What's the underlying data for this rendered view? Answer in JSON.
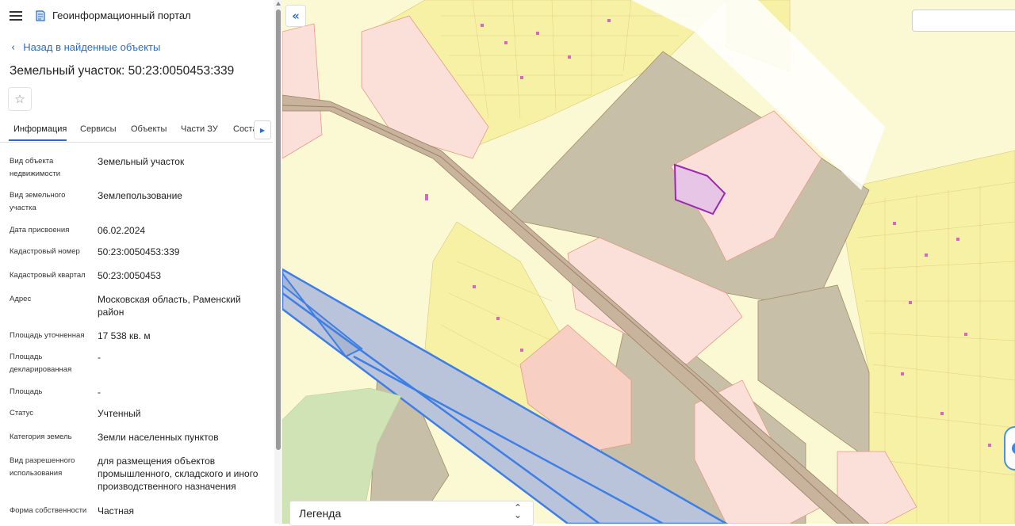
{
  "app": {
    "title": "Геоинформационный портал",
    "logo": "map-book-icon"
  },
  "nav": {
    "back_label": "Назад в найденные объекты",
    "back_icon": "chevron-left-icon"
  },
  "object": {
    "title": "Земельный участок: 50:23:0050453:339"
  },
  "tabs": [
    {
      "label": "Информация",
      "active": true
    },
    {
      "label": "Сервисы"
    },
    {
      "label": "Объекты"
    },
    {
      "label": "Части ЗУ"
    },
    {
      "label": "Соста"
    }
  ],
  "properties": [
    {
      "label": "Вид объекта недвижимости",
      "value": "Земельный участок"
    },
    {
      "label": "Вид земельного участка",
      "value": "Землепользование"
    },
    {
      "label": "Дата присвоения",
      "value": "06.02.2024"
    },
    {
      "label": "Кадастровый номер",
      "value": "50:23:0050453:339"
    },
    {
      "label": "Кадастровый квартал",
      "value": "50:23:0050453"
    },
    {
      "label": "Адрес",
      "value": "Московская область, Раменский район"
    },
    {
      "label": "Площадь уточненная",
      "value": "17 538 кв. м"
    },
    {
      "label": "Площадь декларированная",
      "value": "-"
    },
    {
      "label": "Площадь",
      "value": "-"
    },
    {
      "label": "Статус",
      "value": "Учтенный"
    },
    {
      "label": "Категория земель",
      "value": "Земли населенных пунктов"
    },
    {
      "label": "Вид разрешенного использования",
      "value": "для размещения объектов промышленного, складского и иного производственного назначения"
    },
    {
      "label": "Форма собственности",
      "value": "Частная"
    }
  ],
  "map": {
    "legend_label": "Легенда",
    "colors": {
      "background": "#fbf9d4",
      "residential_yellow": "#f7f1a6",
      "industrial_brown": "#c8bfa8",
      "parcel_pink": "#fbe0da",
      "selected_parcel": "#e7c5e6",
      "selected_border": "#9c2ab0",
      "water_blue": "#b9c3d9",
      "blue_line": "#3d7fe6",
      "green": "#cfe3b4",
      "road": "#ffffff",
      "rail": "#b49f8a"
    }
  }
}
